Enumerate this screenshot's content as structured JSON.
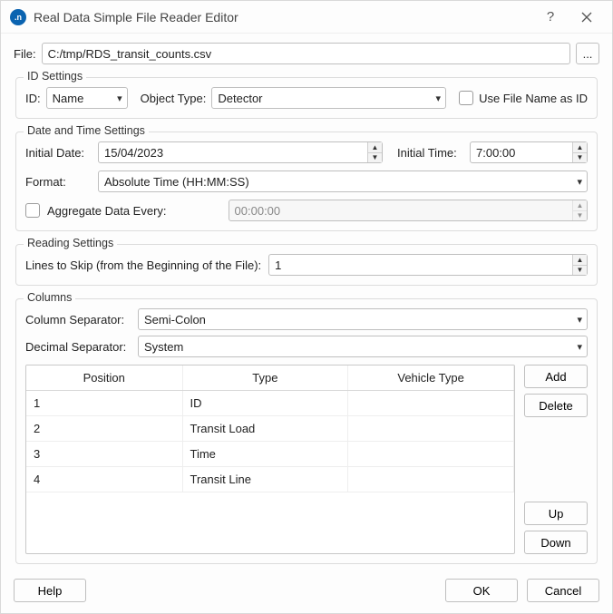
{
  "window": {
    "title": "Real Data Simple File Reader Editor"
  },
  "file": {
    "label": "File:",
    "value": "C:/tmp/RDS_transit_counts.csv",
    "browse": "..."
  },
  "id_settings": {
    "title": "ID Settings",
    "id_label": "ID:",
    "id_value": "Name",
    "object_type_label": "Object Type:",
    "object_type_value": "Detector",
    "use_filename_label": "Use File Name as ID",
    "use_filename_checked": false
  },
  "dt_settings": {
    "title": "Date and Time Settings",
    "initial_date_label": "Initial Date:",
    "initial_date_value": "15/04/2023",
    "initial_time_label": "Initial Time:",
    "initial_time_value": "7:00:00",
    "format_label": "Format:",
    "format_value": "Absolute Time (HH:MM:SS)",
    "aggregate_label": "Aggregate Data Every:",
    "aggregate_checked": false,
    "aggregate_value": "00:00:00"
  },
  "reading": {
    "title": "Reading Settings",
    "lines_label": "Lines to Skip (from the Beginning of the File):",
    "lines_value": "1"
  },
  "columns": {
    "title": "Columns",
    "col_sep_label": "Column Separator:",
    "col_sep_value": "Semi-Colon",
    "dec_sep_label": "Decimal Separator:",
    "dec_sep_value": "System",
    "headers": {
      "position": "Position",
      "type": "Type",
      "vehicle": "Vehicle Type"
    },
    "rows": [
      {
        "position": "1",
        "type": "ID",
        "vehicle": ""
      },
      {
        "position": "2",
        "type": "Transit Load",
        "vehicle": ""
      },
      {
        "position": "3",
        "type": "Time",
        "vehicle": ""
      },
      {
        "position": "4",
        "type": "Transit Line",
        "vehicle": ""
      }
    ],
    "btn_add": "Add",
    "btn_delete": "Delete",
    "btn_up": "Up",
    "btn_down": "Down"
  },
  "footer": {
    "help": "Help",
    "ok": "OK",
    "cancel": "Cancel"
  }
}
